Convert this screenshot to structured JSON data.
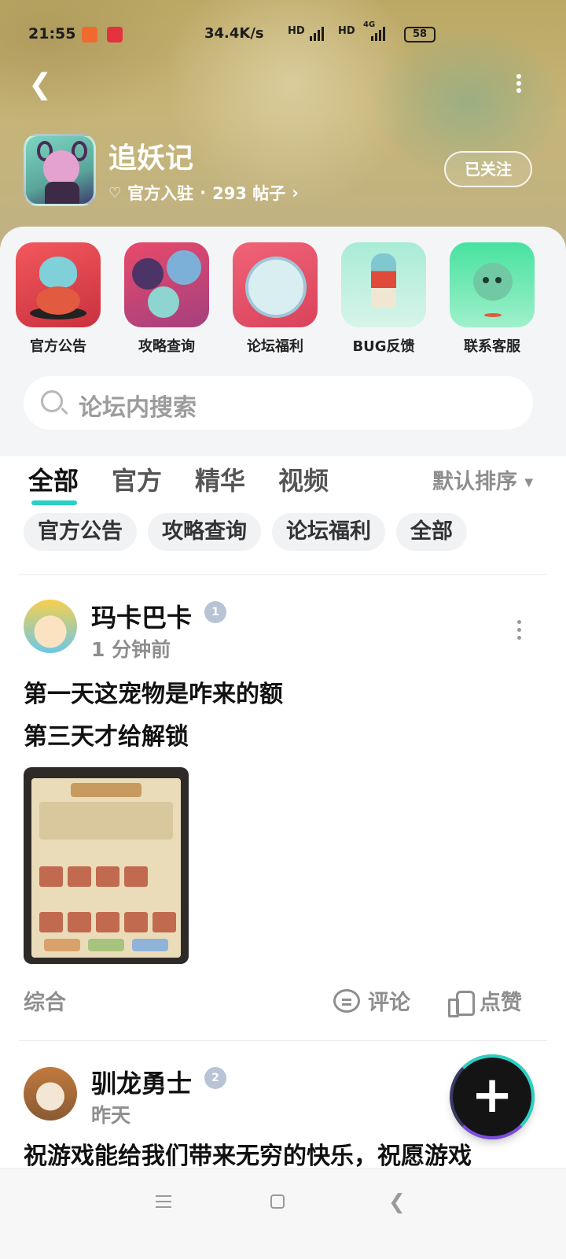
{
  "status_bar": {
    "time": "21:55",
    "speed": "34.4K/s",
    "hd": "HD",
    "net": "4G",
    "battery": "58"
  },
  "header": {
    "game_title": "追妖记",
    "official": "官方入驻",
    "dot": "·",
    "posts": "293 帖子",
    "follow_label": "已关注"
  },
  "quick_menu": [
    {
      "label": "官方公告"
    },
    {
      "label": "攻略查询"
    },
    {
      "label": "论坛福利"
    },
    {
      "label": "BUG反馈"
    },
    {
      "label": "联系客服"
    }
  ],
  "search": {
    "placeholder": "论坛内搜索"
  },
  "tabs": [
    {
      "label": "全部"
    },
    {
      "label": "官方"
    },
    {
      "label": "精华"
    },
    {
      "label": "视频"
    }
  ],
  "sort_label": "默认排序",
  "chips": [
    {
      "label": "官方公告"
    },
    {
      "label": "攻略查询"
    },
    {
      "label": "论坛福利"
    },
    {
      "label": "全部"
    }
  ],
  "posts": [
    {
      "user": "玛卡巴卡",
      "level": "1",
      "time": "1 分钟前",
      "line1": "第一天这宠物是咋来的额",
      "line2": "第三天才给解锁",
      "category": "综合",
      "comment_label": "评论",
      "like_label": "点赞"
    },
    {
      "user": "驯龙勇士",
      "level": "2",
      "time": "昨天",
      "line1": "祝游戏能给我们带来无穷的快乐，祝愿游戏"
    }
  ],
  "fab_label": "+",
  "colors": {
    "accent": "#2ad1c2",
    "banner": "#c6b477"
  },
  "icons": [
    "back-icon",
    "more-icon",
    "heart-icon",
    "search-icon",
    "comment-icon",
    "like-icon",
    "plus-icon"
  ]
}
